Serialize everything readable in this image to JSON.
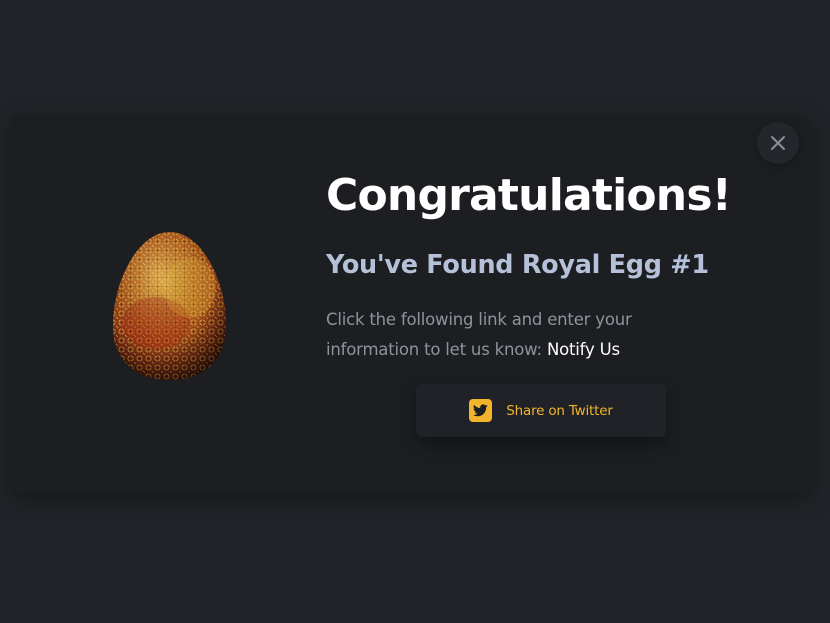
{
  "modal": {
    "title": "Congratulations!",
    "subtitle": "You've Found Royal Egg #1",
    "message": "Click the following link and enter your information to let us know:",
    "link_label": "Notify Us",
    "share_button_label": "Share on Twitter",
    "close_icon": "close-icon",
    "twitter_icon": "twitter-icon",
    "egg_image": "royal-egg-image"
  },
  "colors": {
    "page_background": "#212328",
    "modal_background": "#1c1e22",
    "title": "#ffffff",
    "subtitle": "#b5c1d8",
    "body_text": "#8e939c",
    "accent": "#f2b42b"
  }
}
